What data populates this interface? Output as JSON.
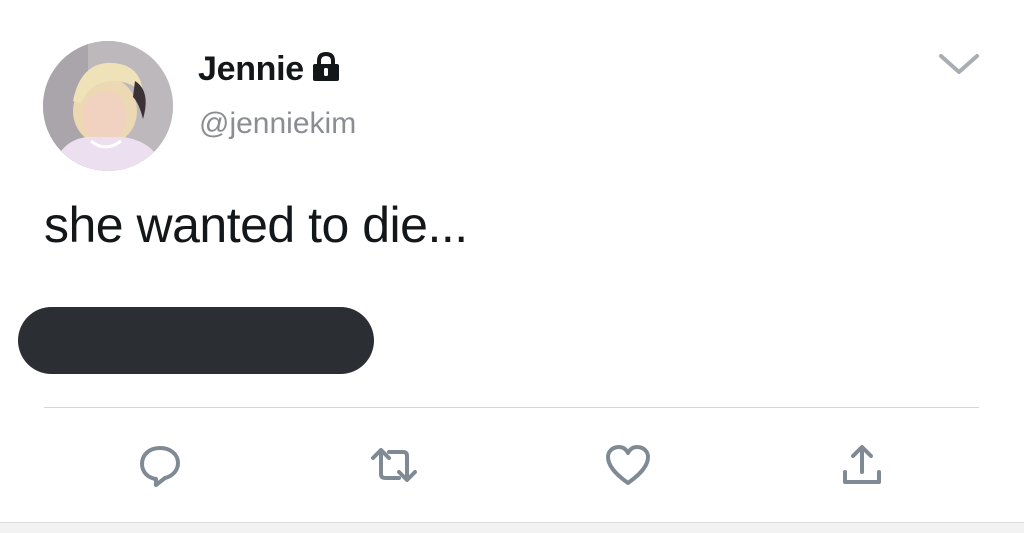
{
  "author": {
    "display_name": "Jennie",
    "handle": "@jenniekim",
    "protected": true,
    "avatar_icon": "profile-photo"
  },
  "tweet": {
    "text": "she wanted to die..."
  },
  "icons": {
    "lock": "lock-icon",
    "menu": "chevron-down-icon",
    "reply": "reply-icon",
    "retweet": "retweet-icon",
    "like": "heart-icon",
    "share": "share-icon"
  },
  "colors": {
    "text": "#14171a",
    "muted": "#8a8d91",
    "icon": "#7f8a94",
    "redaction": "#2b2f33",
    "divider": "#d4d6d8"
  }
}
